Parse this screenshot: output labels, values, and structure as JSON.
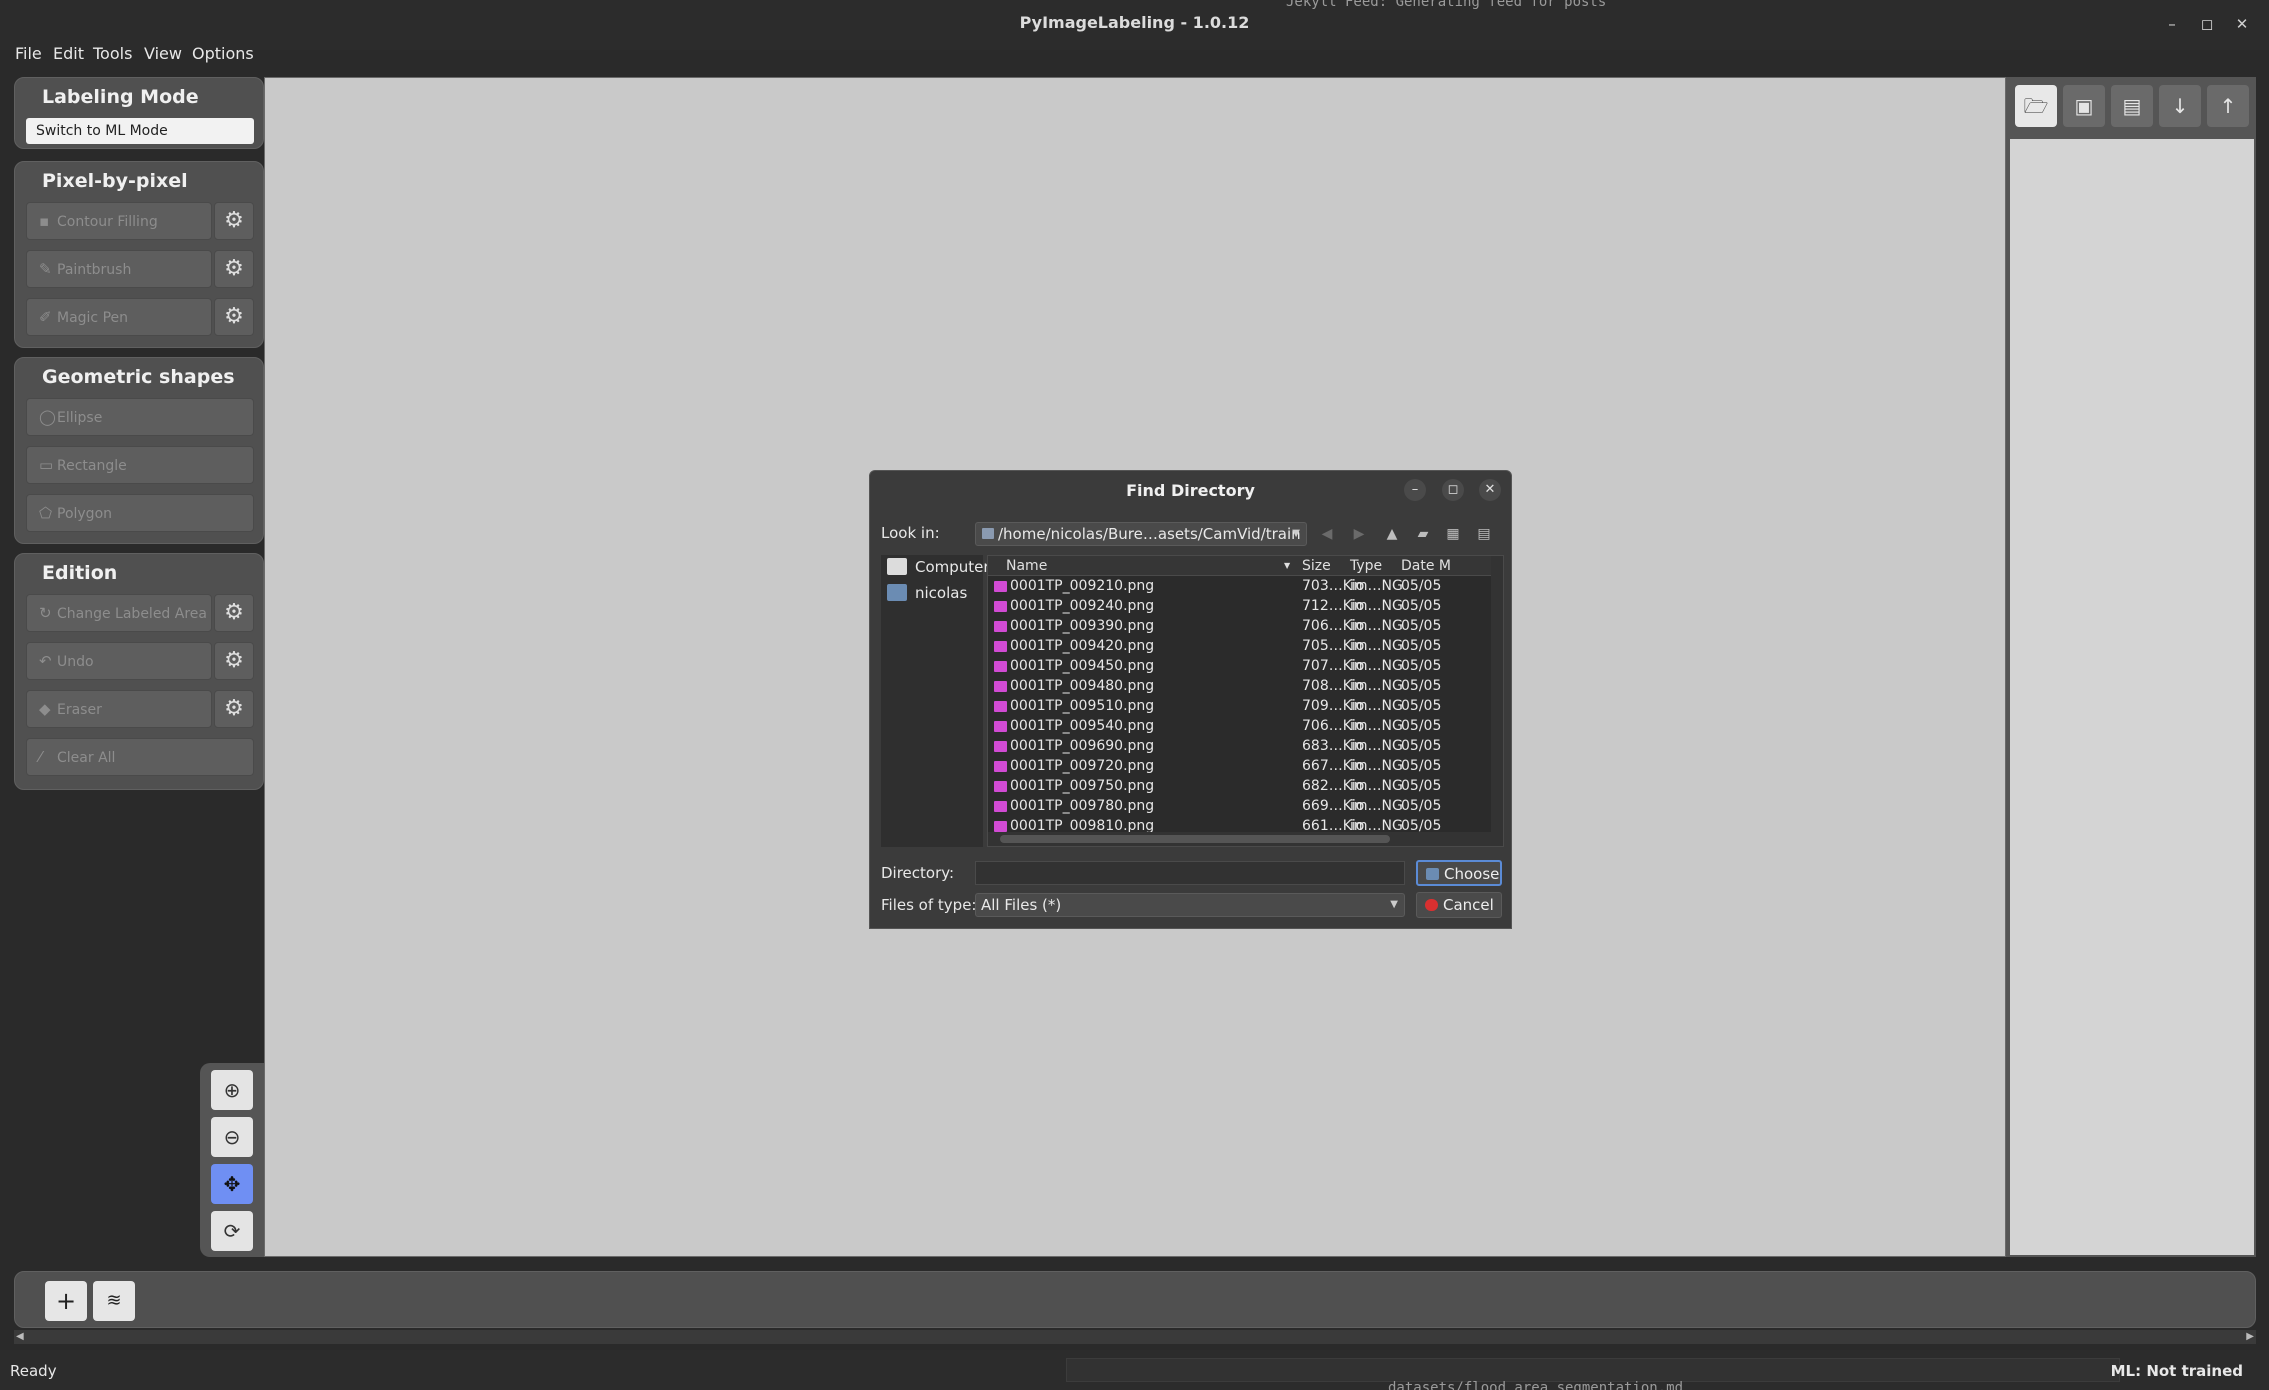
{
  "window": {
    "title": "PyImageLabeling - 1.0.12"
  },
  "background_text": {
    "top": "Jekyll Feed: Generating feed for posts",
    "bottom": "datasets/flood_area_segmentation.md"
  },
  "menu": [
    "File",
    "Edit",
    "Tools",
    "View",
    "Options"
  ],
  "labeling_mode": {
    "title": "Labeling Mode",
    "switch_label": "Switch to ML Mode"
  },
  "pixel_group": {
    "title": "Pixel-by-pixel",
    "tools": [
      "Contour Filling",
      "Paintbrush",
      "Magic Pen"
    ]
  },
  "geometric_group": {
    "title": "Geometric shapes",
    "tools": [
      "Ellipse",
      "Rectangle",
      "Polygon"
    ]
  },
  "edition_group": {
    "title": "Edition",
    "tools": [
      "Change Labeled Area",
      "Undo",
      "Eraser",
      "Clear All"
    ]
  },
  "right_toolbar": [
    "open-folder-icon",
    "save-icon",
    "save-as-icon",
    "download-icon",
    "upload-icon"
  ],
  "zoom_tools": [
    "zoom-in-icon",
    "zoom-out-icon",
    "move-icon",
    "reset-view-icon"
  ],
  "bottom_bar": [
    "add-icon",
    "layers-icon"
  ],
  "status": {
    "left": "Ready",
    "right": "ML: Not trained"
  },
  "dialog": {
    "title": "Find Directory",
    "look_in_label": "Look in:",
    "look_in_path": "/home/nicolas/Bure…asets/CamVid/train",
    "sidebar": [
      "Computer",
      "nicolas"
    ],
    "columns": {
      "name": "Name",
      "size": "Size",
      "type": "Type",
      "date": "Date M"
    },
    "files": [
      {
        "name": "0001TP_009210.png",
        "size": "703…Kio",
        "type": "im…NG",
        "date": "05/05"
      },
      {
        "name": "0001TP_009240.png",
        "size": "712…Kio",
        "type": "im…NG",
        "date": "05/05"
      },
      {
        "name": "0001TP_009390.png",
        "size": "706…Kio",
        "type": "im…NG",
        "date": "05/05"
      },
      {
        "name": "0001TP_009420.png",
        "size": "705…Kio",
        "type": "im…NG",
        "date": "05/05"
      },
      {
        "name": "0001TP_009450.png",
        "size": "707…Kio",
        "type": "im…NG",
        "date": "05/05"
      },
      {
        "name": "0001TP_009480.png",
        "size": "708…Kio",
        "type": "im…NG",
        "date": "05/05"
      },
      {
        "name": "0001TP_009510.png",
        "size": "709…Kio",
        "type": "im…NG",
        "date": "05/05"
      },
      {
        "name": "0001TP_009540.png",
        "size": "706…Kio",
        "type": "im…NG",
        "date": "05/05"
      },
      {
        "name": "0001TP_009690.png",
        "size": "683…Kio",
        "type": "im…NG",
        "date": "05/05"
      },
      {
        "name": "0001TP_009720.png",
        "size": "667…Kio",
        "type": "im…NG",
        "date": "05/05"
      },
      {
        "name": "0001TP_009750.png",
        "size": "682…Kio",
        "type": "im…NG",
        "date": "05/05"
      },
      {
        "name": "0001TP_009780.png",
        "size": "669…Kio",
        "type": "im…NG",
        "date": "05/05"
      },
      {
        "name": "0001TP_009810.png",
        "size": "661…Kio",
        "type": "im…NG",
        "date": "05/05"
      }
    ],
    "directory_label": "Directory:",
    "directory_value": "",
    "files_of_type_label": "Files of type:",
    "files_of_type_value": "All Files (*)",
    "choose_label": "Choose",
    "cancel_label": "Cancel"
  },
  "colors": {
    "canvas": "#c9c9c9",
    "panel": "#505050",
    "accent": "#6f8ff3",
    "file_icon": "#d14bd3"
  }
}
